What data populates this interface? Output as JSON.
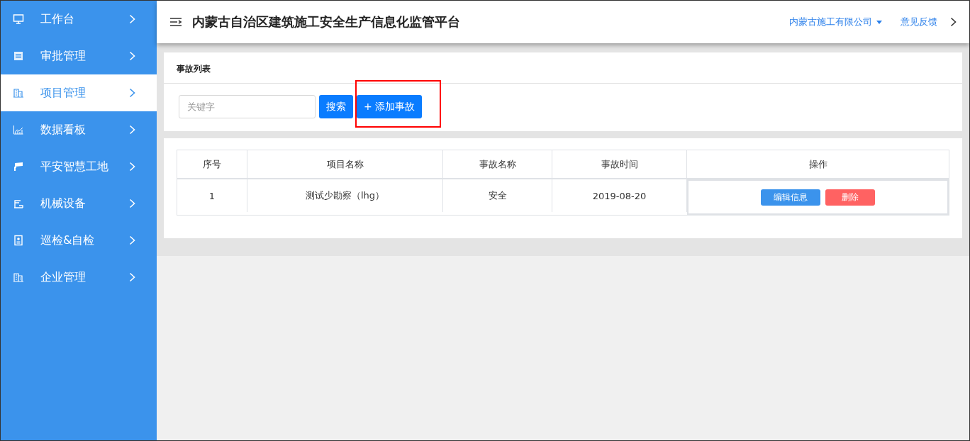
{
  "sidebar": {
    "items": [
      {
        "label": "工作台",
        "selected": false
      },
      {
        "label": "审批管理",
        "selected": false
      },
      {
        "label": "项目管理",
        "selected": true
      },
      {
        "label": "数据看板",
        "selected": false
      },
      {
        "label": "平安智慧工地",
        "selected": false
      },
      {
        "label": "机械设备",
        "selected": false
      },
      {
        "label": "巡检&自检",
        "selected": false
      },
      {
        "label": "企业管理",
        "selected": false
      }
    ]
  },
  "header": {
    "title": "内蒙古自治区建筑施工安全生产信息化监管平台",
    "company": "内蒙古施工有限公司",
    "feedback": "意见反馈"
  },
  "panel": {
    "title": "事故列表",
    "search": {
      "placeholder": "关键字"
    },
    "search_button": "搜索",
    "add_button": {
      "label": "+ 添加事故",
      "highlighted": true
    }
  },
  "table": {
    "columns": [
      "序号",
      "项目名称",
      "事故名称",
      "事故时间",
      "操作"
    ],
    "rows": [
      {
        "cells": [
          "1",
          "测试少勘察（lhg）",
          "安全",
          "2019-08-20"
        ],
        "actions": [
          {
            "label": "编辑信息",
            "kind": "edit"
          },
          {
            "label": "删除",
            "kind": "delete"
          }
        ]
      }
    ]
  }
}
